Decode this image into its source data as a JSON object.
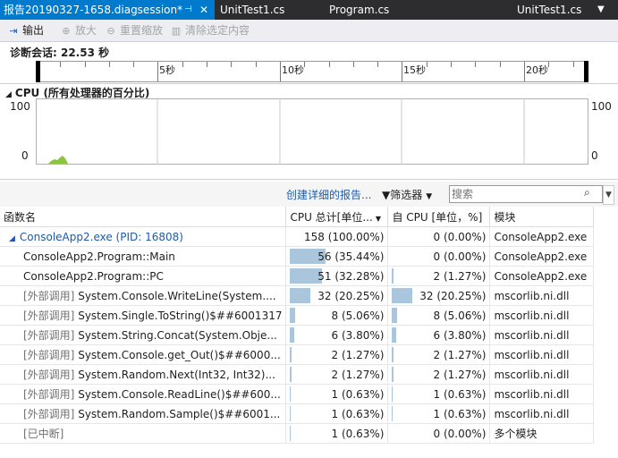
{
  "tabs": [
    {
      "label": "报告20190327-1658.diagsession*",
      "active": true
    },
    {
      "label": "UnitTest1.cs",
      "active": false
    },
    {
      "label": "Program.cs",
      "active": false
    },
    {
      "label": "UnitTest1.cs",
      "active": false
    }
  ],
  "toolbar": {
    "export": "输出",
    "zoom_in": "放大",
    "reset_zoom": "重置缩放",
    "clear_selection": "清除选定内容"
  },
  "session": {
    "duration_label": "诊断会话: 22.53 秒"
  },
  "ruler": {
    "ticks": [
      "5秒",
      "10秒",
      "15秒",
      "20秒"
    ]
  },
  "cpu_graph": {
    "title": "CPU (所有处理器的百分比)",
    "y_max": "100",
    "y_min": "0"
  },
  "details": {
    "create_report": "创建详细的报告...",
    "filter": "筛选器",
    "search_placeholder": "搜索"
  },
  "table": {
    "headers": {
      "name": "函数名",
      "total_cpu": "CPU 总计[单位...",
      "self_cpu": "自 CPU [单位，%]",
      "module": "模块"
    },
    "rows": [
      {
        "prefix": "",
        "name": "ConsoleApp2.exe (PID: 16808)",
        "total": "158 (100.00%)",
        "total_pct": 100,
        "self": "0 (0.00%)",
        "self_pct": 0,
        "module": "ConsoleApp2.exe"
      },
      {
        "prefix": "",
        "name": "ConsoleApp2.Program::Main",
        "total": "56 (35.44%)",
        "total_pct": 35.44,
        "self": "0 (0.00%)",
        "self_pct": 0,
        "module": "ConsoleApp2.exe"
      },
      {
        "prefix": "",
        "name": "ConsoleApp2.Program::PC",
        "total": "51 (32.28%)",
        "total_pct": 32.28,
        "self": "2 (1.27%)",
        "self_pct": 1.27,
        "module": "ConsoleApp2.exe"
      },
      {
        "prefix": "[外部调用]",
        "name": "System.Console.WriteLine(System....",
        "total": "32 (20.25%)",
        "total_pct": 20.25,
        "self": "32 (20.25%)",
        "self_pct": 20.25,
        "module": "mscorlib.ni.dll"
      },
      {
        "prefix": "[外部调用]",
        "name": "System.Single.ToString()$##6001317",
        "total": "8 (5.06%)",
        "total_pct": 5.06,
        "self": "8 (5.06%)",
        "self_pct": 5.06,
        "module": "mscorlib.ni.dll"
      },
      {
        "prefix": "[外部调用]",
        "name": "System.String.Concat(System.Obje...",
        "total": "6 (3.80%)",
        "total_pct": 3.8,
        "self": "6 (3.80%)",
        "self_pct": 3.8,
        "module": "mscorlib.ni.dll"
      },
      {
        "prefix": "[外部调用]",
        "name": "System.Console.get_Out()$##6000...",
        "total": "2 (1.27%)",
        "total_pct": 1.27,
        "self": "2 (1.27%)",
        "self_pct": 1.27,
        "module": "mscorlib.ni.dll"
      },
      {
        "prefix": "[外部调用]",
        "name": "System.Random.Next(Int32, Int32)...",
        "total": "2 (1.27%)",
        "total_pct": 1.27,
        "self": "2 (1.27%)",
        "self_pct": 1.27,
        "module": "mscorlib.ni.dll"
      },
      {
        "prefix": "[外部调用]",
        "name": "System.Console.ReadLine()$##600...",
        "total": "1 (0.63%)",
        "total_pct": 0.63,
        "self": "1 (0.63%)",
        "self_pct": 0.63,
        "module": "mscorlib.ni.dll"
      },
      {
        "prefix": "[外部调用]",
        "name": "System.Random.Sample()$##6001...",
        "total": "1 (0.63%)",
        "total_pct": 0.63,
        "self": "1 (0.63%)",
        "self_pct": 0.63,
        "module": "mscorlib.ni.dll"
      },
      {
        "prefix": "[已中断]",
        "name": "",
        "total": "1 (0.63%)",
        "total_pct": 0.63,
        "self": "0 (0.00%)",
        "self_pct": 0,
        "module": "多个模块"
      }
    ]
  },
  "colors": {
    "accent": "#007acc",
    "bar": "#a9c6dd",
    "cpu_line": "#8cc63f",
    "link": "#1e5aa8"
  }
}
